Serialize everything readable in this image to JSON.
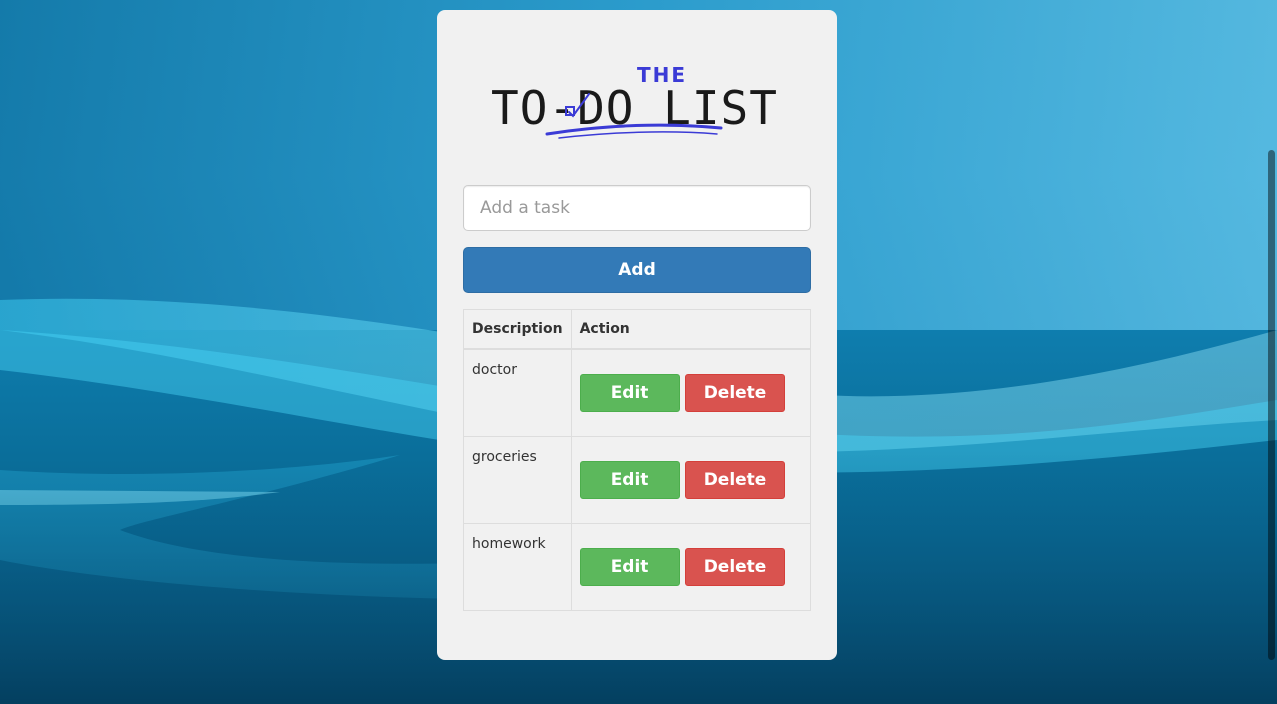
{
  "logo": {
    "text_small": "THE",
    "text_main": "TO-DO LIST"
  },
  "form": {
    "placeholder": "Add a task",
    "value": "",
    "add_label": "Add"
  },
  "table": {
    "headers": [
      "Description",
      "Action"
    ],
    "rows": [
      {
        "description": "doctor",
        "edit_label": "Edit",
        "delete_label": "Delete"
      },
      {
        "description": "groceries",
        "edit_label": "Edit",
        "delete_label": "Delete"
      },
      {
        "description": "homework",
        "edit_label": "Edit",
        "delete_label": "Delete"
      }
    ]
  },
  "colors": {
    "primary": "#337ab7",
    "success": "#5cb85c",
    "danger": "#d9534f",
    "card": "#f1f1f1",
    "logo_accent": "#3b3bd6"
  }
}
